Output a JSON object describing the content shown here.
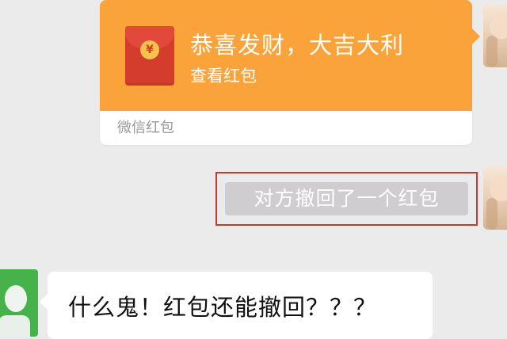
{
  "red_packet": {
    "title": "恭喜发财，大吉大利",
    "action": "查看红包",
    "footer": "微信红包",
    "coin_symbol": "¥"
  },
  "recall_notice": {
    "text": "对方撤回了一个红包"
  },
  "message": {
    "text": "什么鬼！红包还能撤回？？？"
  },
  "colors": {
    "packet_orange": "#f9a33a",
    "packet_red": "#d43c2c",
    "highlight_red": "#c63a32",
    "notice_gray": "#cfcdcf",
    "chat_background": "#ebebeb",
    "avatar_green": "#46b24a"
  },
  "icons": {
    "packet": "red-envelope-icon"
  }
}
